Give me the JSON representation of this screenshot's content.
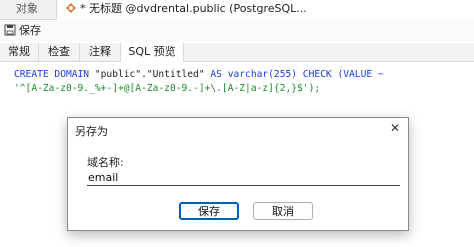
{
  "tabs": {
    "objects": "对象",
    "query": "* 无标题 @dvdrental.public (PostgreSQL..."
  },
  "toolbar": {
    "save": "保存"
  },
  "subtabs": [
    "常规",
    "检查",
    "注释",
    "SQL 预览"
  ],
  "sql": {
    "line1_kw": "CREATE DOMAIN",
    "line1_name": " \"public\".\"Untitled\" ",
    "line1_rest": "AS varchar(255) CHECK (VALUE ~",
    "line2": "'^[A-Za-z0-9._%+-]+@[A-Za-z0-9.-]+\\.[A-Z|a-z]{2,}$');"
  },
  "dialog": {
    "title": "另存为",
    "label": "域名称:",
    "value": "email",
    "save_button": "保存",
    "cancel_button": "取消",
    "close_glyph": "✕"
  }
}
